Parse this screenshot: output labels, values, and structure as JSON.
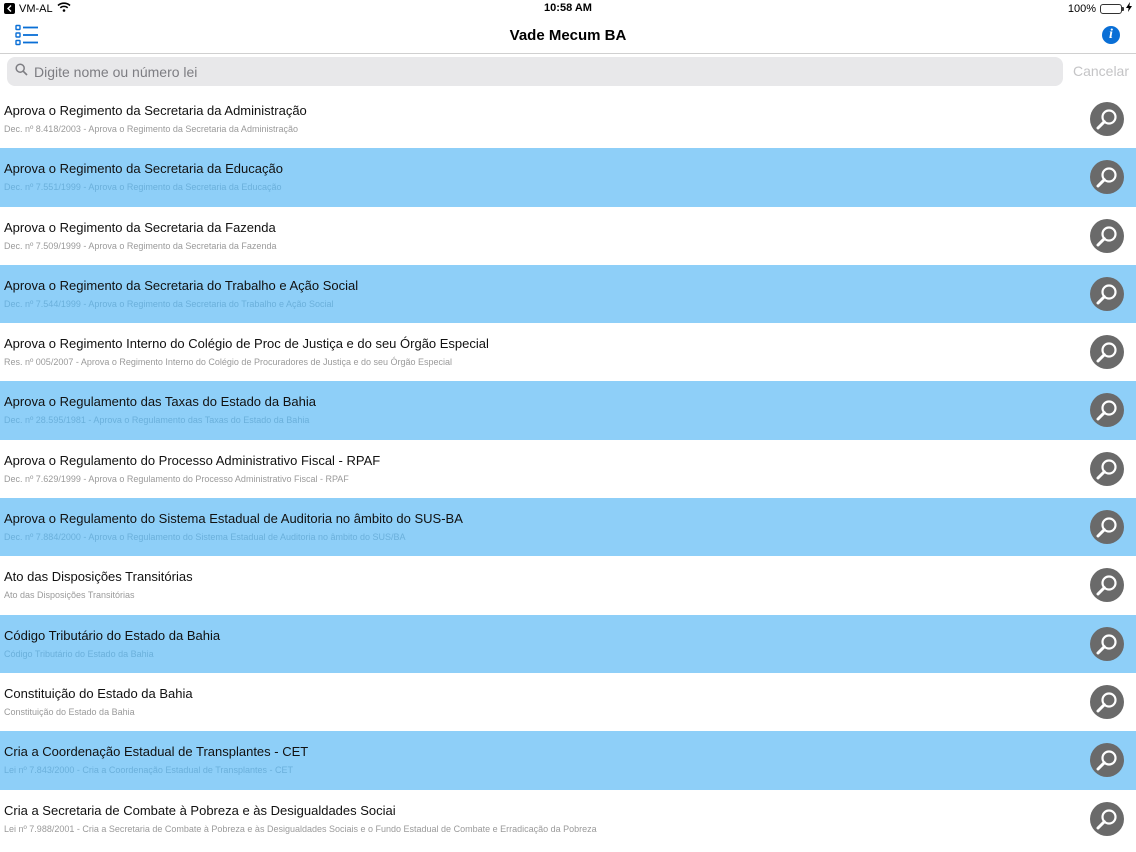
{
  "status_bar": {
    "carrier": "VM-AL",
    "time": "10:58 AM",
    "battery": "100%",
    "battery_level": 1.0
  },
  "nav": {
    "title": "Vade Mecum BA"
  },
  "search": {
    "placeholder": "Digite nome ou número lei",
    "cancel_label": "Cancelar"
  },
  "colors": {
    "alt_row": "#8ecff8",
    "info_accent": "#0a6fd6",
    "action_button": "#6a6a6a"
  },
  "items": [
    {
      "title": "Aprova o Regimento da Secretaria da Administração",
      "subtitle": "Dec. nº 8.418/2003 - Aprova o Regimento da Secretaria da Administração"
    },
    {
      "title": "Aprova o Regimento da Secretaria da Educação",
      "subtitle": "Dec. nº 7.551/1999 - Aprova o Regimento da Secretaria da Educação"
    },
    {
      "title": "Aprova o Regimento da Secretaria da Fazenda",
      "subtitle": "Dec. nº 7.509/1999 - Aprova o Regimento da Secretaria da Fazenda"
    },
    {
      "title": "Aprova o Regimento da Secretaria do Trabalho e Ação Social",
      "subtitle": "Dec. nº 7.544/1999 - Aprova o Regimento da Secretaria do Trabalho e Ação Social"
    },
    {
      "title": "Aprova o Regimento Interno do Colégio de Proc de Justiça e do seu Órgão Especial",
      "subtitle": "Res. nº 005/2007 - Aprova o Regimento Interno do Colégio de Procuradores de Justiça e do seu Órgão Especial"
    },
    {
      "title": "Aprova o Regulamento das Taxas do Estado da Bahia",
      "subtitle": "Dec. nº 28.595/1981 - Aprova o Regulamento das Taxas do Estado da Bahia"
    },
    {
      "title": "Aprova o Regulamento do Processo Administrativo Fiscal - RPAF",
      "subtitle": "Dec. nº 7.629/1999 - Aprova o Regulamento do Processo Administrativo Fiscal - RPAF"
    },
    {
      "title": "Aprova o Regulamento do Sistema Estadual de Auditoria no âmbito do SUS-BA",
      "subtitle": "Dec. nº 7.884/2000 - Aprova o Regulamento do Sistema Estadual de Auditoria no âmbito do SUS/BA"
    },
    {
      "title": "Ato das Disposições Transitórias",
      "subtitle": "Ato das Disposições Transitórias"
    },
    {
      "title": "Código Tributário do Estado da Bahia",
      "subtitle": "Código Tributário do Estado da Bahia"
    },
    {
      "title": "Constituição do Estado da Bahia",
      "subtitle": "Constituição do Estado da Bahia"
    },
    {
      "title": "Cria a Coordenação Estadual de Transplantes - CET",
      "subtitle": "Lei nº 7.843/2000 - Cria a Coordenação Estadual de Transplantes - CET"
    },
    {
      "title": "Cria a Secretaria de Combate à Pobreza e às Desigualdades Sociai",
      "subtitle": "Lei nº 7.988/2001 - Cria a Secretaria de Combate à Pobreza e às Desigualdades Sociais e o Fundo Estadual de Combate e Erradicação da Pobreza"
    }
  ]
}
